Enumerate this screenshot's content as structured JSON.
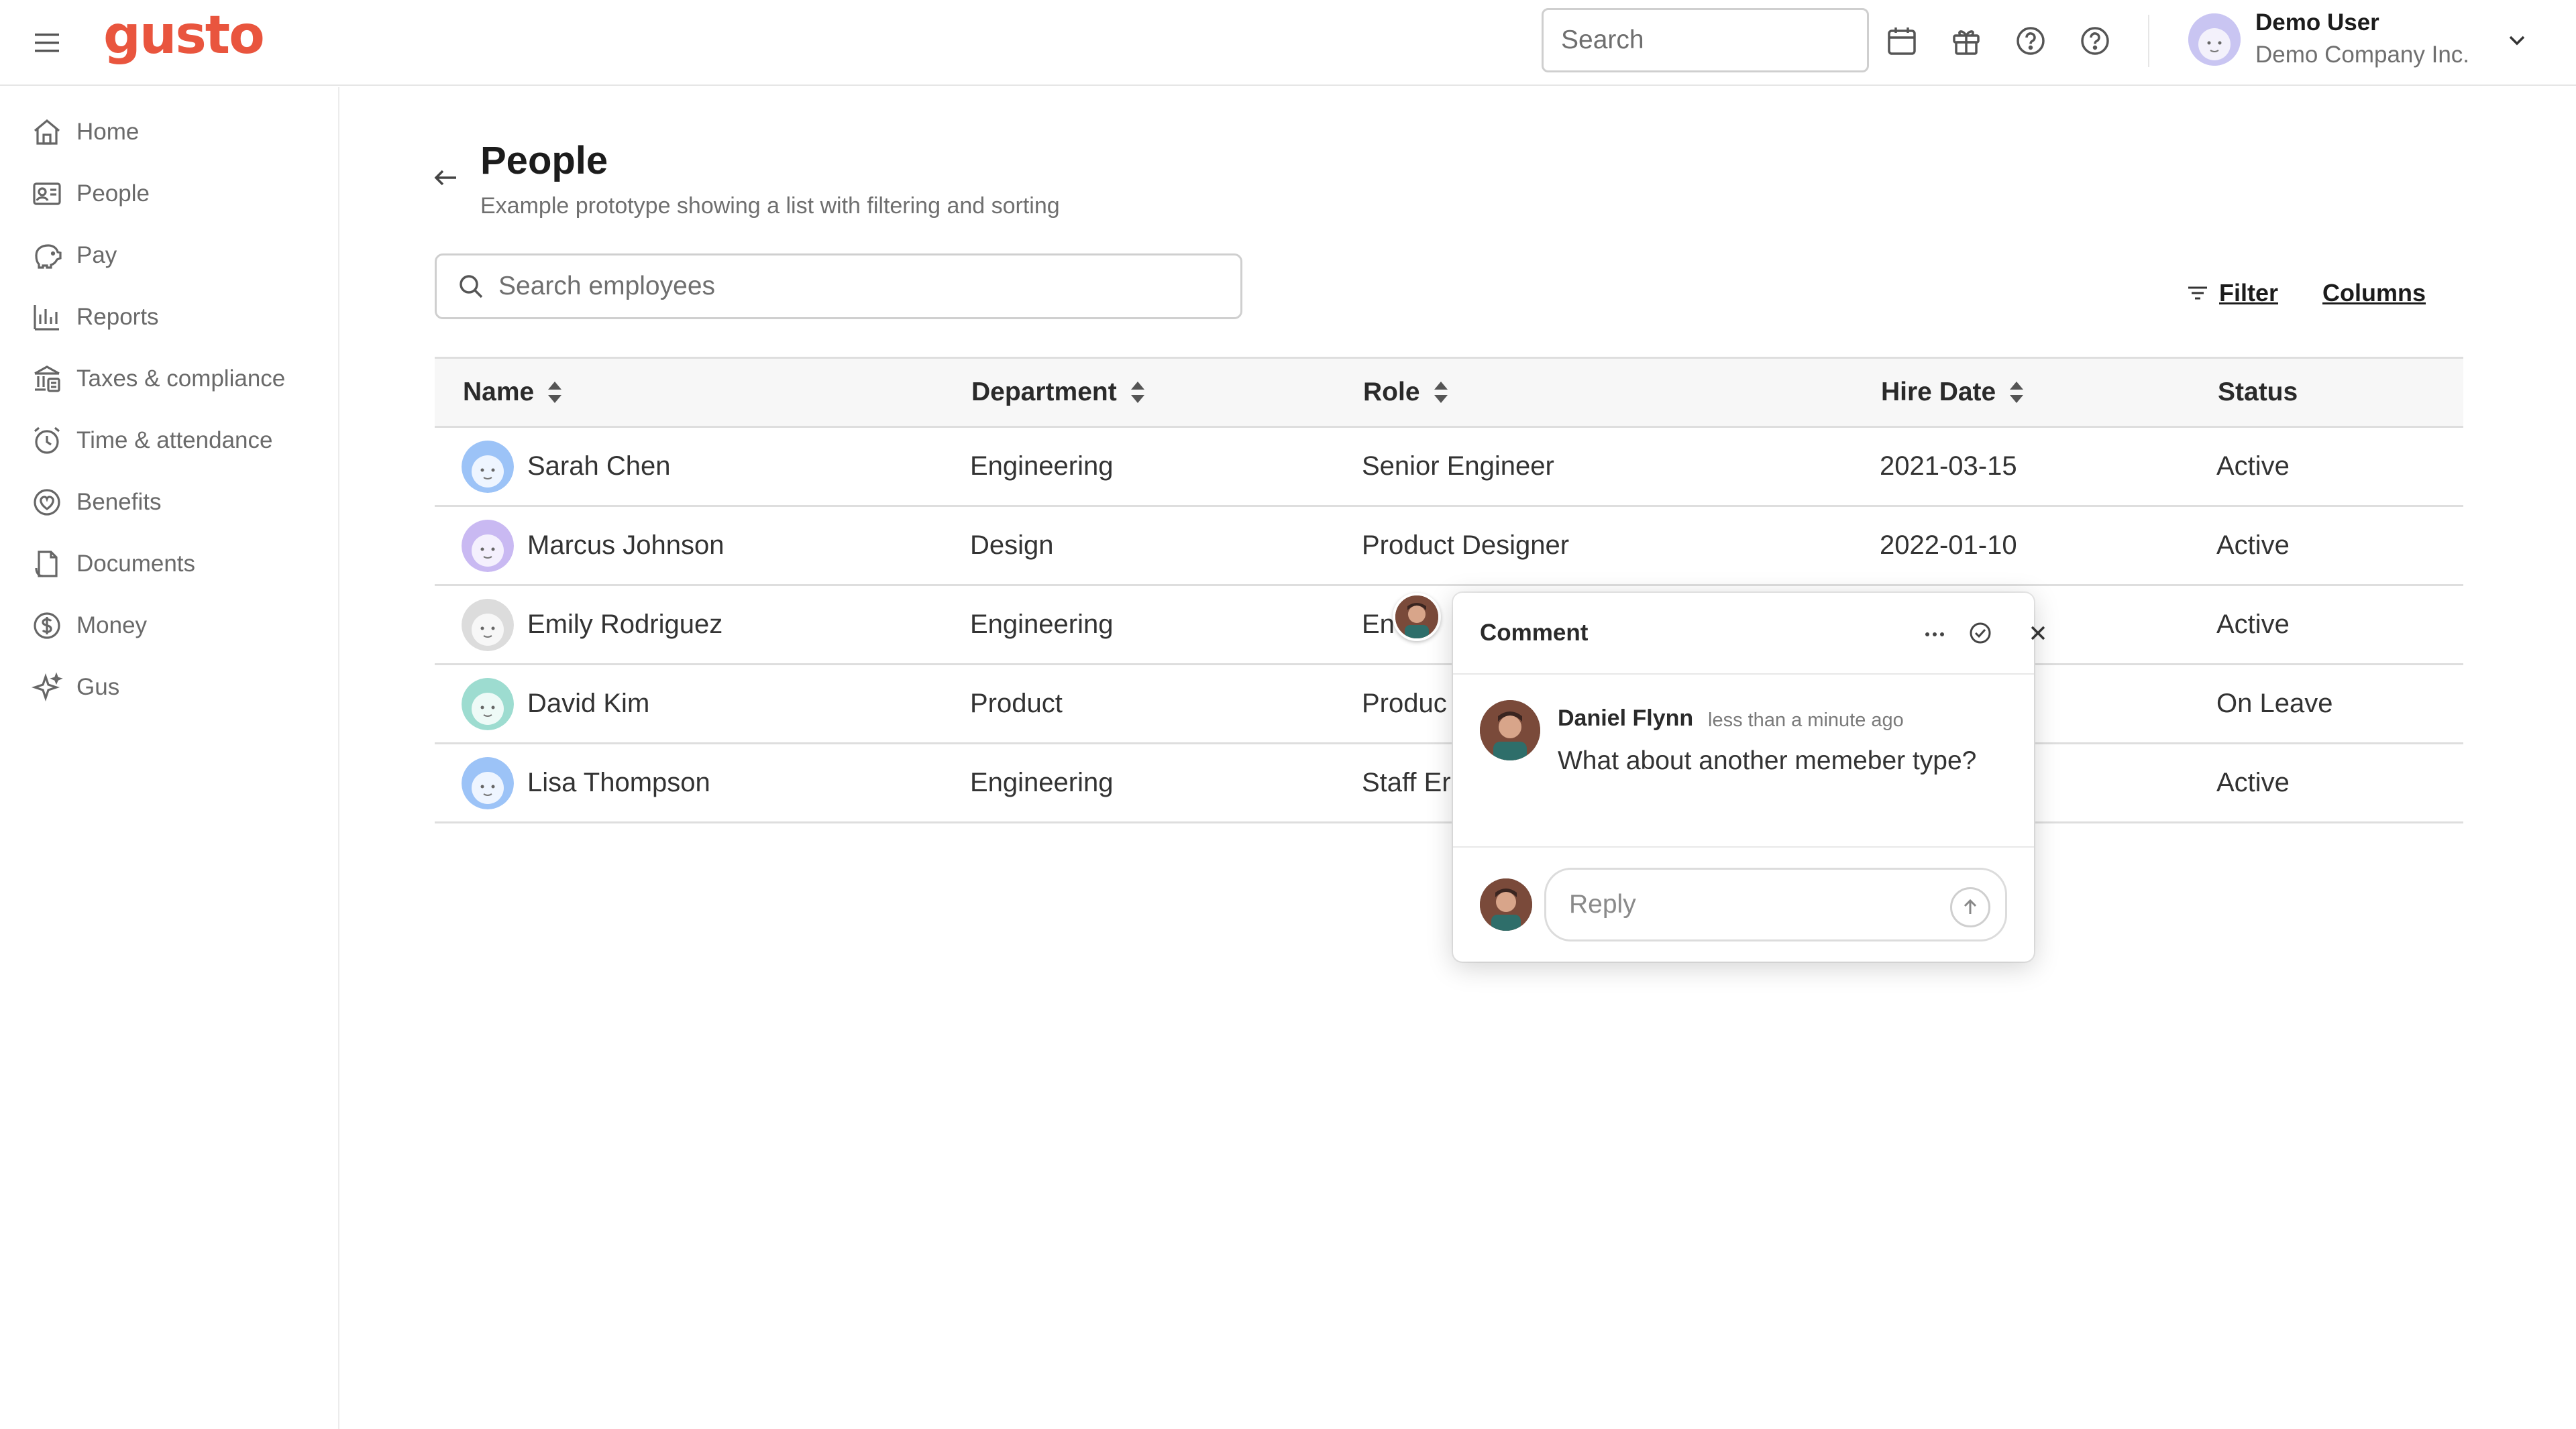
{
  "app": {
    "logo": "gusto",
    "brand_color": "#e9553e"
  },
  "topbar": {
    "search_placeholder": "Search",
    "icons": [
      "calendar-icon",
      "gift-icon",
      "help-icon",
      "help-icon"
    ],
    "user": {
      "name": "Demo User",
      "company": "Demo Company Inc."
    }
  },
  "sidebar": {
    "items": [
      {
        "label": "Home",
        "icon": "home-icon"
      },
      {
        "label": "People",
        "icon": "people-icon"
      },
      {
        "label": "Pay",
        "icon": "pay-icon"
      },
      {
        "label": "Reports",
        "icon": "reports-icon"
      },
      {
        "label": "Taxes & compliance",
        "icon": "taxes-icon"
      },
      {
        "label": "Time & attendance",
        "icon": "clock-icon"
      },
      {
        "label": "Benefits",
        "icon": "heart-icon"
      },
      {
        "label": "Documents",
        "icon": "documents-icon"
      },
      {
        "label": "Money",
        "icon": "money-icon"
      },
      {
        "label": "Gus",
        "icon": "sparkle-icon"
      }
    ]
  },
  "page": {
    "title": "People",
    "subtitle": "Example prototype showing a list with filtering and sorting",
    "search_placeholder": "Search employees",
    "filter_label": "Filter",
    "columns_label": "Columns"
  },
  "table": {
    "headers": {
      "name": "Name",
      "department": "Department",
      "role": "Role",
      "hire_date": "Hire Date",
      "status": "Status"
    },
    "rows": [
      {
        "name": "Sarah Chen",
        "department": "Engineering",
        "role": "Senior Engineer",
        "hire_date": "2021-03-15",
        "status": "Active",
        "avatar_color": "#9cc3f7"
      },
      {
        "name": "Marcus Johnson",
        "department": "Design",
        "role": "Product Designer",
        "hire_date": "2022-01-10",
        "status": "Active",
        "avatar_color": "#c9b9f2"
      },
      {
        "name": "Emily Rodriguez",
        "department": "Engineering",
        "role": "En",
        "hire_date": "",
        "status": "Active",
        "avatar_color": "#dcdcdc"
      },
      {
        "name": "David Kim",
        "department": "Product",
        "role": "Produc",
        "hire_date": "",
        "status": "On Leave",
        "avatar_color": "#9ddcd0"
      },
      {
        "name": "Lisa Thompson",
        "department": "Engineering",
        "role": "Staff Er",
        "hire_date": "",
        "status": "Active",
        "avatar_color": "#9cc3f7"
      }
    ]
  },
  "comment": {
    "title": "Comment",
    "author": "Daniel Flynn",
    "time": "less than a minute ago",
    "body": "What about another memeber type?",
    "reply_placeholder": "Reply"
  }
}
